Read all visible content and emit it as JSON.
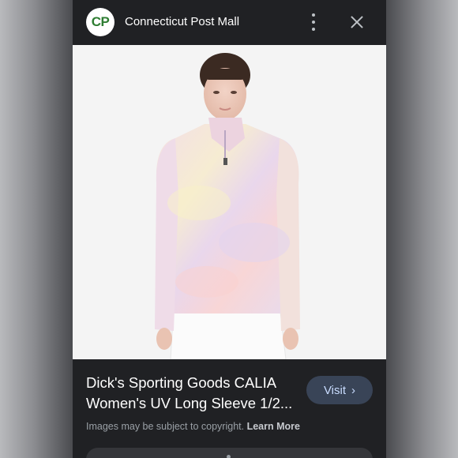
{
  "source": {
    "logo_text": "CP",
    "name": "Connecticut Post Mall"
  },
  "product": {
    "title_line1": "Dick's Sporting Goods CALIA",
    "title_line2": "Women's UV Long Sleeve 1/2...",
    "image_alt": "model-wearing-pastel-tie-dye-half-zip-long-sleeve"
  },
  "actions": {
    "visit_label": "Visit",
    "visit_chevron": "›",
    "more_icon": "more-vertical-icon",
    "close_icon": "close-icon"
  },
  "notice": {
    "text": "Images may be subject to copyright.",
    "link": "Learn More"
  },
  "colors": {
    "panel": "#202124",
    "logo_green": "#2e7d32",
    "visit_bg": "#394457",
    "visit_text": "#c9dcff"
  }
}
